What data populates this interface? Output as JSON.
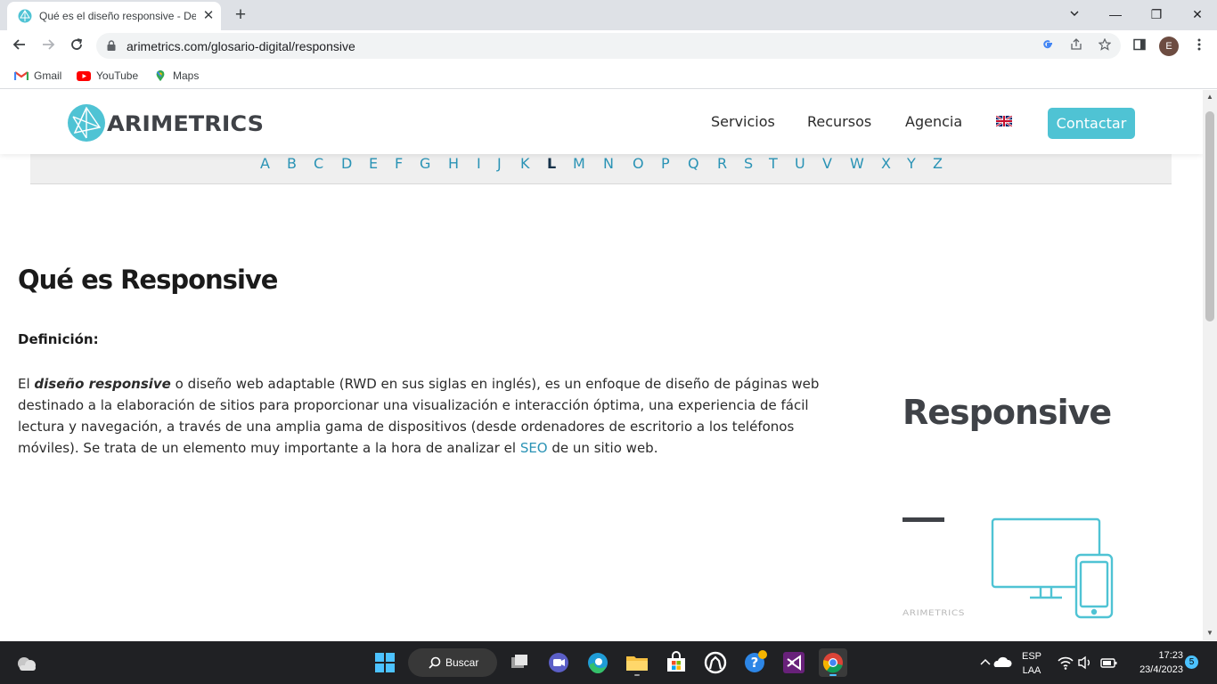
{
  "browser": {
    "tab": {
      "title": "Qué es el diseño responsive - De",
      "close": "✕"
    },
    "new_tab": "+",
    "window": {
      "minimize": "—",
      "restore": "❐",
      "close": "✕"
    },
    "address": {
      "url": "arimetrics.com/glosario-digital/responsive"
    },
    "profile_initial": "E",
    "bookmarks": [
      {
        "label": "Gmail",
        "icon": "gmail-icon"
      },
      {
        "label": "YouTube",
        "icon": "youtube-icon"
      },
      {
        "label": "Maps",
        "icon": "maps-icon"
      }
    ]
  },
  "site": {
    "nav": [
      "Servicios",
      "Recursos",
      "Agencia"
    ],
    "cta": "Contactar",
    "alphabet": [
      "A",
      "B",
      "C",
      "D",
      "E",
      "F",
      "G",
      "H",
      "I",
      "J",
      "K",
      "L",
      "M",
      "N",
      "O",
      "P",
      "Q",
      "R",
      "S",
      "T",
      "U",
      "V",
      "W",
      "X",
      "Y",
      "Z"
    ],
    "active_letter": "L",
    "title": "Qué es Responsive",
    "definition_label": "Definición:",
    "body": {
      "prefix": "El ",
      "term": "diseño responsive",
      "middle": " o diseño web adaptable (RWD en sus siglas en inglés), es un enfoque de diseño de páginas web destinado a la elaboración de sitios para proporcionar una visualización e interacción óptima, una experiencia de fácil lectura y navegación, a través de una amplia gama de dispositivos (desde ordenadores de escritorio a los teléfonos móviles). Se trata de un elemento muy importante a la hora de analizar el ",
      "link": "SEO",
      "suffix": " de un sitio web."
    },
    "side_card": {
      "title": "Responsive"
    }
  },
  "taskbar": {
    "search_label": "Buscar",
    "lang_top": "ESP",
    "lang_bottom": "LAA",
    "time": "17:23",
    "date": "23/4/2023",
    "notifications": "5"
  },
  "colors": {
    "brand_teal": "#4fc3d4",
    "link_blue": "#2a93b5",
    "logo_dark": "#3f4247"
  }
}
